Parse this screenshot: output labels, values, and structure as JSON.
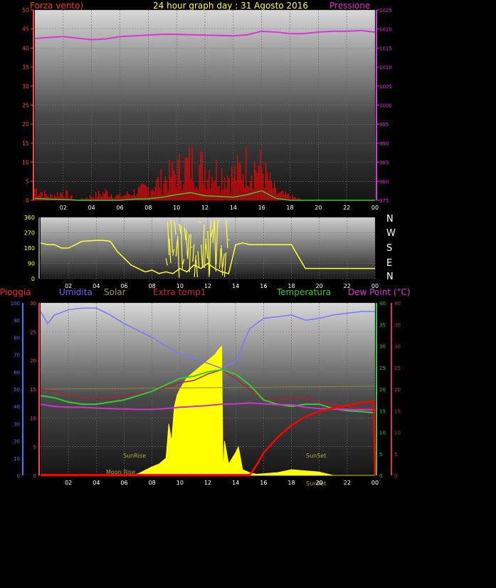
{
  "header": {
    "left_title": "Forza vento)",
    "center_title": "24 hour graph day : 31 Agosto 2016",
    "right_title": "Pressione"
  },
  "colors": {
    "background": "#000000",
    "wind": "#ff0000",
    "wind_avg": "#33cc33",
    "pressure": "#dd33dd",
    "direction": "#ffff33",
    "humidity": "#7777ff",
    "solar": "#ffff00",
    "solar_max": "#888833",
    "extra_temp": "#aa2233",
    "temperature": "#33cc33",
    "dew_point": "#cc33cc",
    "rain": "#ff0000",
    "axis_left": "#ff4444",
    "axis_blue": "#6666ff",
    "axis_green": "#33cc33",
    "axis_pink": "#cc3366"
  },
  "chart_data": [
    {
      "id": "wind_pressure",
      "type": "line",
      "x_ticks": [
        "02",
        "04",
        "06",
        "08",
        "10",
        "12",
        "14",
        "16",
        "18",
        "20",
        "22",
        "00"
      ],
      "y_left": {
        "label": "Forza vento)",
        "ticks": [
          "0",
          "5",
          "10",
          "15",
          "20",
          "25",
          "30",
          "35",
          "40",
          "45",
          "50"
        ],
        "ylim": [
          0,
          50
        ]
      },
      "y_right": {
        "label": "Pressione",
        "ticks": [
          "975",
          "980",
          "985",
          "990",
          "995",
          "1000",
          "1005",
          "1010",
          "1015",
          "1020",
          "1025"
        ],
        "ylim": [
          975,
          1025
        ]
      },
      "series": [
        {
          "name": "Pressione",
          "x": [
            0,
            1,
            2,
            3,
            4,
            5,
            6,
            7,
            8,
            9,
            10,
            11,
            12,
            13,
            14,
            15,
            16,
            17,
            18,
            19,
            20,
            21,
            22,
            23,
            24
          ],
          "values": [
            1017.5,
            1017.8,
            1018.0,
            1017.6,
            1017.2,
            1017.4,
            1018.0,
            1018.2,
            1018.4,
            1018.6,
            1018.6,
            1018.5,
            1018.4,
            1018.3,
            1018.2,
            1018.5,
            1019.4,
            1019.2,
            1018.8,
            1018.8,
            1019.2,
            1019.4,
            1019.4,
            1019.6,
            1019.2
          ]
        },
        {
          "name": "",
          "x": [
            0,
            1,
            2,
            3,
            4,
            5,
            6,
            7,
            8,
            9,
            10,
            11,
            12,
            13,
            14,
            15,
            16,
            17,
            18,
            19,
            20,
            21,
            22,
            23,
            24
          ],
          "values": [
            3,
            1,
            2,
            0,
            1,
            2,
            1,
            2,
            3,
            5,
            7,
            9,
            8,
            7,
            6,
            9,
            8,
            2,
            1,
            0,
            0,
            0,
            0,
            0,
            0
          ]
        },
        {
          "name": "",
          "x": [
            0,
            1,
            2,
            3,
            4,
            5,
            6,
            7,
            8,
            9,
            10,
            11,
            12,
            13,
            14,
            15,
            16,
            17,
            18,
            19,
            20,
            21,
            22,
            23,
            24
          ],
          "values": [
            0.5,
            0.3,
            0.2,
            0,
            0,
            0,
            0,
            0.3,
            0.4,
            0.8,
            1.5,
            2.0,
            1.2,
            1.0,
            0.8,
            1.5,
            2.5,
            0.5,
            0,
            0,
            0,
            0,
            0,
            0,
            0
          ]
        }
      ]
    },
    {
      "id": "wind_direction",
      "type": "line",
      "x_ticks": [
        "02",
        "04",
        "06",
        "08",
        "10",
        "12",
        "14",
        "16",
        "18",
        "20",
        "22",
        "00"
      ],
      "y_left": {
        "ticks": [
          "0",
          "90",
          "180",
          "270",
          "360"
        ],
        "ylim": [
          0,
          360
        ]
      },
      "y_right_labels": [
        "N",
        "W",
        "S",
        "E",
        "N"
      ],
      "series": [
        {
          "name": "",
          "x": [
            0,
            0.5,
            1,
            1.5,
            2,
            3,
            4,
            4.5,
            5,
            5.5,
            6,
            6.5,
            7,
            7.5,
            8,
            8.5,
            9,
            9.5,
            10,
            10.5,
            11,
            11.5,
            12,
            12.5,
            13,
            13.5,
            14,
            14.5,
            15,
            15.5,
            16,
            17,
            18,
            19,
            20,
            21,
            22,
            23,
            24
          ],
          "values": [
            210,
            200,
            200,
            180,
            180,
            220,
            225,
            225,
            220,
            160,
            120,
            80,
            60,
            40,
            50,
            30,
            40,
            30,
            60,
            40,
            80,
            60,
            90,
            60,
            40,
            30,
            200,
            210,
            200,
            200,
            200,
            200,
            200,
            60,
            60,
            60,
            60,
            60,
            60
          ]
        }
      ]
    },
    {
      "id": "temperature_combo",
      "type": "area",
      "x_ticks": [
        "02",
        "04",
        "06",
        "08",
        "10",
        "12",
        "14",
        "16",
        "18",
        "20",
        "22",
        "00"
      ],
      "legend": [
        "Pioggia",
        "Umidita",
        "Solar",
        "Extra temp1",
        "Temperatura",
        "Dew Point (°C)"
      ],
      "y_axes": [
        {
          "label": "Pioggia",
          "ticks": [
            "0",
            "10",
            "20",
            "30",
            "40",
            "50",
            "60",
            "70",
            "80",
            "90",
            "100"
          ],
          "ylim": [
            0,
            100
          ]
        },
        {
          "label": "Solar",
          "ticks": [
            "0",
            "5",
            "10",
            "15",
            "20",
            "25",
            "30"
          ],
          "ylim": [
            0,
            30
          ]
        },
        {
          "label": "Temperatura",
          "ticks": [
            "0",
            "5",
            "10",
            "15",
            "20",
            "25",
            "30",
            "35",
            "40"
          ],
          "ylim": [
            0,
            40
          ]
        },
        {
          "label": "Dew Point (°C)",
          "ticks": [
            "0",
            "5",
            "10",
            "15",
            "20",
            "25",
            "30",
            "35",
            "40"
          ],
          "ylim": [
            0,
            40
          ]
        }
      ],
      "annotations": [
        "SunRise",
        "Moon Rise",
        "SunSet",
        "SunSet"
      ],
      "series": [
        {
          "name": "Umidita",
          "x": [
            0,
            0.5,
            1,
            2,
            3,
            4,
            5,
            6,
            7,
            8,
            9,
            10,
            11,
            12,
            13,
            14,
            15,
            16,
            17,
            18,
            19,
            20,
            21,
            22,
            23,
            24
          ],
          "values": [
            95,
            88,
            93,
            96,
            97,
            97,
            93,
            88,
            84,
            80,
            75,
            70,
            68,
            65,
            62,
            66,
            85,
            91,
            92,
            93,
            90,
            91,
            93,
            94,
            95,
            95
          ]
        },
        {
          "name": "Temperatura",
          "x": [
            0,
            1,
            2,
            3,
            4,
            5,
            6,
            7,
            8,
            9,
            10,
            11,
            12,
            13,
            14,
            15,
            16,
            17,
            18,
            19,
            20,
            21,
            22,
            23,
            24
          ],
          "values": [
            18.5,
            18.0,
            17.0,
            16.5,
            16.5,
            17.0,
            17.5,
            18.5,
            19.5,
            21.0,
            22.5,
            23.0,
            24.0,
            24.5,
            23.5,
            21.0,
            17.5,
            16.5,
            16.0,
            16.5,
            16.5,
            15.5,
            15.0,
            14.8,
            14.5
          ]
        },
        {
          "name": "Extra temp1",
          "x": [
            0,
            1,
            2,
            3,
            4,
            5,
            6,
            7,
            8,
            9,
            10,
            11,
            12,
            13,
            14,
            15,
            16,
            17,
            18,
            19,
            20,
            21,
            22,
            23,
            24
          ],
          "values": [
            20.0,
            19.5,
            18.5,
            18.0,
            18.0,
            18.0,
            18.5,
            19.0,
            19.5,
            20.5,
            21.5,
            22.0,
            23.5,
            24.5,
            22.5,
            20.0,
            17.5,
            17.5,
            18.0,
            18.0,
            17.0,
            16.5,
            16.0,
            15.5,
            15.5
          ]
        },
        {
          "name": "Dew Point (°C)",
          "x": [
            0,
            1,
            2,
            3,
            4,
            5,
            6,
            7,
            8,
            9,
            10,
            11,
            12,
            13,
            14,
            15,
            16,
            17,
            18,
            19,
            20,
            21,
            22,
            23,
            24
          ],
          "values": [
            16.5,
            16.0,
            15.8,
            15.8,
            15.6,
            15.5,
            15.4,
            15.3,
            15.3,
            15.5,
            15.8,
            16.0,
            16.2,
            16.5,
            16.6,
            16.8,
            16.6,
            16.4,
            16.4,
            15.8,
            15.5,
            15.4,
            15.3,
            15.2,
            15.2
          ]
        },
        {
          "name": "Pioggia",
          "x": [
            0,
            15,
            15.5,
            16,
            17,
            18,
            19,
            20,
            21,
            22,
            23,
            23.9,
            24
          ],
          "values": [
            0,
            0,
            6,
            13,
            22,
            29,
            34,
            37,
            39,
            40.5,
            42,
            43,
            0
          ]
        },
        {
          "name": "Solar",
          "x": [
            0,
            6.5,
            7,
            8,
            8.5,
            9,
            9.2,
            9.4,
            9.6,
            9.8,
            10,
            10.5,
            11,
            11.5,
            12,
            12.5,
            12.8,
            13,
            13.1,
            13.2,
            13.5,
            14,
            14.2,
            14.5,
            15,
            15.5,
            16,
            17,
            18,
            19,
            20,
            20.5,
            21,
            24
          ],
          "values": [
            0,
            0,
            0.3,
            1.5,
            2,
            3,
            9,
            6,
            12,
            14,
            15,
            17,
            18,
            19,
            20,
            21,
            22,
            22.5,
            0.5,
            6,
            2,
            4,
            5,
            1,
            0.5,
            0.2,
            0.3,
            0.5,
            1,
            0.8,
            0.6,
            0.3,
            0,
            0
          ]
        },
        {
          "name": "",
          "x": [
            0,
            24
          ],
          "values": [
            15,
            15.5
          ]
        }
      ]
    }
  ]
}
